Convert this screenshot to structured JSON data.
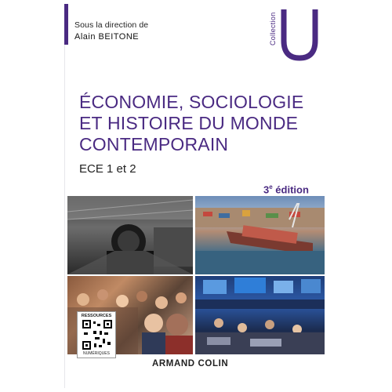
{
  "cover": {
    "direction_label": "Sous la direction de",
    "author": "Alain BEITONE",
    "collection_label": "Collection",
    "collection_letter": "U",
    "title_lines": [
      "ÉCONOMIE, SOCIOLOGIE",
      "ET HISTOIRE DU MONDE",
      "CONTEMPORAIN"
    ],
    "subtitle": "ECE 1 et 2",
    "edition_number": "3",
    "edition_suffix": "e",
    "edition_word": " édition",
    "qr_top_label": "RESSOURCES",
    "qr_bottom_label": "NUMÉRIQUES",
    "publisher": "ARMAND COLIN"
  },
  "colors": {
    "brand_purple": "#4a2a82",
    "text_dark": "#222222"
  },
  "photos": [
    {
      "name": "steam-locomotive-photo"
    },
    {
      "name": "container-port-photo"
    },
    {
      "name": "crowd-photo"
    },
    {
      "name": "trading-floor-photo"
    }
  ]
}
